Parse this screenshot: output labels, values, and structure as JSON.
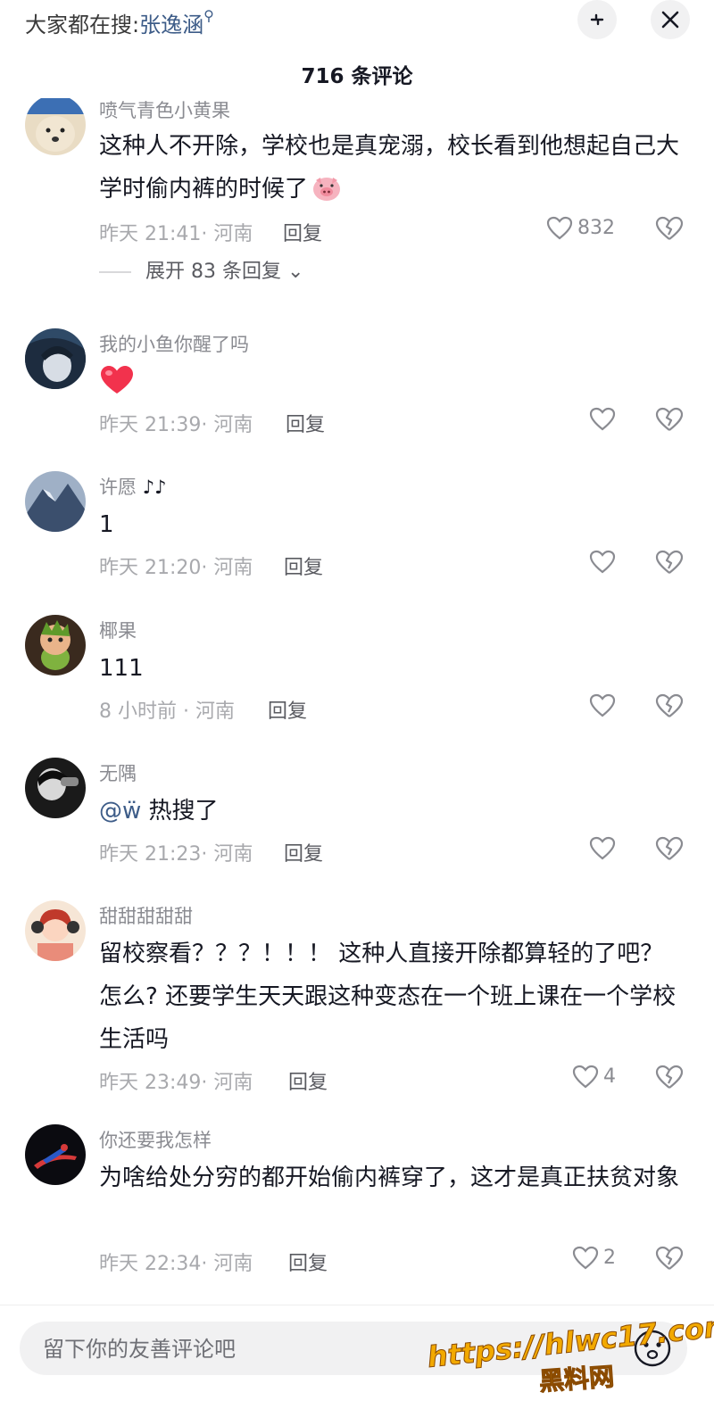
{
  "header": {
    "search_prefix": "大家都在搜:",
    "search_keyword": "张逸涵",
    "comment_count": "716 条评论"
  },
  "colors": {
    "link": "#3d5c88",
    "text": "#161823",
    "muted": "#a8a9ad"
  },
  "comments": [
    {
      "username": "喷气青色小黄果",
      "text": "这种人不开除，学校也是真宠溺，校长看到他想起自己大学时偷内裤的时候了",
      "emoji": "pig-face-emoji",
      "meta": "昨天 21:41· 河南",
      "reply_label": "回复",
      "likes": "832",
      "expand_label": "展开 83 条回复"
    },
    {
      "username": "我的小鱼你醒了吗",
      "text": "",
      "emoji": "red-heart-emoji",
      "meta": "昨天 21:39· 河南",
      "reply_label": "回复",
      "likes": ""
    },
    {
      "username": "许愿",
      "username_suffix": "♪♪",
      "text": "1",
      "meta": "昨天 21:20· 河南",
      "reply_label": "回复",
      "likes": ""
    },
    {
      "username": "椰果",
      "text": "111",
      "meta": "8 小时前 · 河南",
      "reply_label": "回复",
      "likes": ""
    },
    {
      "username": "无隅",
      "mention": "@ẅ",
      "text": " 热搜了",
      "meta": "昨天 21:23· 河南",
      "reply_label": "回复",
      "likes": ""
    },
    {
      "username": "甜甜甜甜甜",
      "text": "留校察看？？？！！！ 这种人直接开除都算轻的了吧？ 怎么? 还要学生天天跟这种变态在一个班上课在一个学校生活吗",
      "meta": "昨天 23:49· 河南",
      "reply_label": "回复",
      "likes": "4"
    },
    {
      "username": "你还要我怎样",
      "text": "为啥给处分穷的都开始偷内裤穿了，这才是真正扶贫对象",
      "meta": "昨天 22:34· 河南",
      "reply_label": "回复",
      "likes": "2"
    }
  ],
  "footer": {
    "input_placeholder": "留下你的友善评论吧",
    "watermark_url": "https://hlwc17.com",
    "watermark_cn": "黑料网"
  }
}
